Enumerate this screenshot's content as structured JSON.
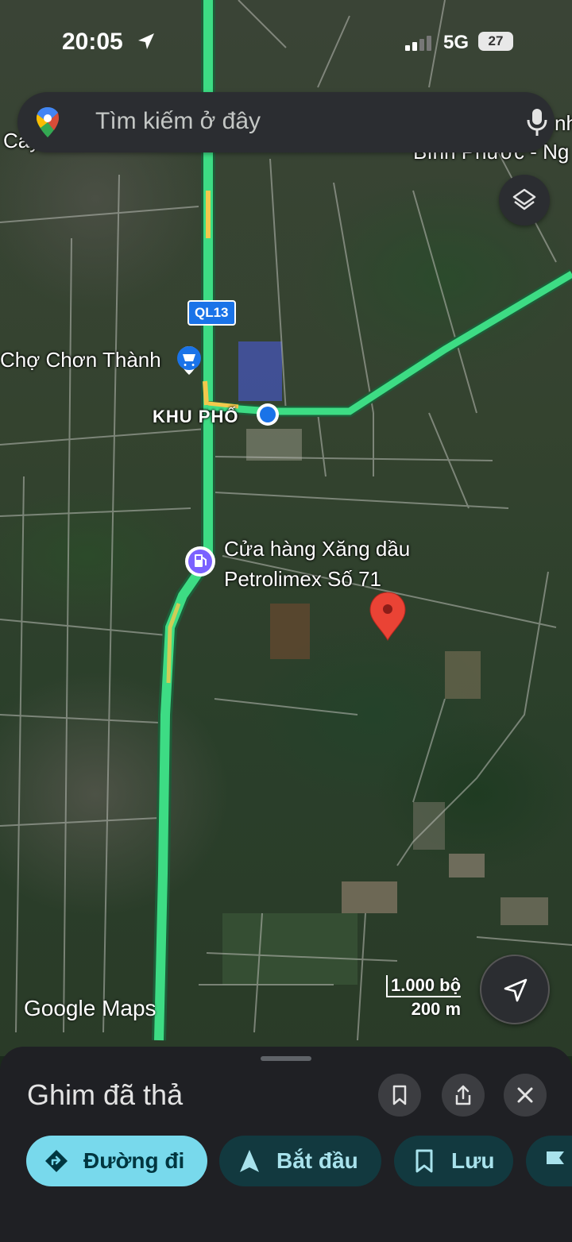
{
  "status_bar": {
    "time": "20:05",
    "network": "5G",
    "battery": "27"
  },
  "search": {
    "placeholder": "Tìm kiếm ở đây"
  },
  "map": {
    "place_labels": {
      "cho_chon_thanh": "Chợ Chơn Thành",
      "khu_pho": "KHU PHỐ",
      "gas_station_line1": "Cửa hàng Xăng dầu",
      "gas_station_line2": "Petrolimex Số 71",
      "top_left_partial": "Cay",
      "top_right_partial_1": "nh",
      "top_right_partial_2": "Bình Phước - Ng"
    },
    "road_shield": "QL13",
    "scale": {
      "imperial": "1.000 bộ",
      "metric": "200 m"
    },
    "attribution": "Google Maps"
  },
  "sheet": {
    "title": "Ghim đã thả",
    "chips": [
      {
        "label": "Đường đi"
      },
      {
        "label": "Bắt đầu"
      },
      {
        "label": "Lưu"
      }
    ]
  },
  "colors": {
    "route": "#3ddc84",
    "pin": "#ea4335",
    "location_dot": "#1a73e8",
    "primary_chip": "#78d9ec",
    "sheet_bg": "#1f2024"
  }
}
